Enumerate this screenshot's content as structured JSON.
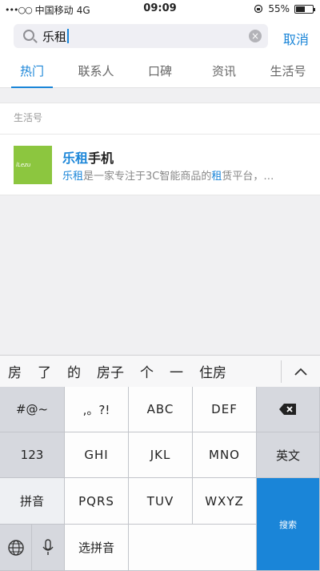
{
  "status_bar": {
    "signal": "•••○○",
    "carrier": "中国移动",
    "network": "4G",
    "time": "09:09",
    "battery_text": "55%",
    "battery_level": 0.55
  },
  "search": {
    "query": "乐租",
    "cancel_label": "取消"
  },
  "tabs": [
    {
      "label": "热门",
      "active": true
    },
    {
      "label": "联系人",
      "active": false
    },
    {
      "label": "口碑",
      "active": false
    },
    {
      "label": "资讯",
      "active": false
    },
    {
      "label": "生活号",
      "active": false
    }
  ],
  "section": {
    "title": "生活号"
  },
  "result": {
    "logo_text": "lLezu",
    "title_highlight": "乐租",
    "title_rest": "手机",
    "desc_hl1": "乐租",
    "desc_mid": "是一家专注于3C智能商品的",
    "desc_hl2": "租",
    "desc_end": "赁平台，…"
  },
  "candidates": [
    "房",
    "了",
    "的",
    "房子",
    "个",
    "一",
    "住房"
  ],
  "keyboard": {
    "symbols": "#@~",
    "punct": ",。?!",
    "abc": "ABC",
    "def": "DEF",
    "num": "123",
    "ghi": "GHI",
    "jkl": "JKL",
    "mno": "MNO",
    "english": "英文",
    "pinyin": "拼音",
    "pqrs": "PQRS",
    "tuv": "TUV",
    "wxyz": "WXYZ",
    "select_pinyin": "选拼音",
    "enter": "搜索"
  },
  "colors": {
    "accent": "#1a85d8",
    "logo_green": "#8cc63f"
  }
}
